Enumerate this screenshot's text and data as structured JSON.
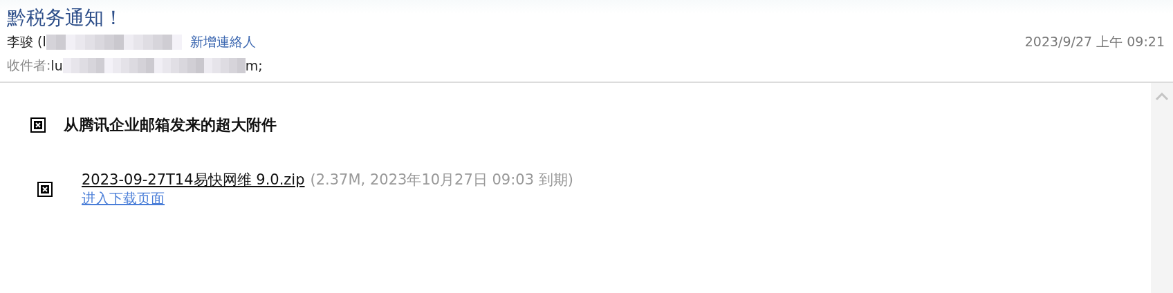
{
  "subject": "黔税务通知！",
  "sender": {
    "name": "李骏 (l",
    "add_contact": "新增連絡人"
  },
  "date": "2023/9/27 上午 09:21",
  "recipient": {
    "label": "收件者:",
    "value_start": "lu",
    "value_end": "m;"
  },
  "body": {
    "heading": "从腾讯企业邮箱发来的超大附件",
    "attachments": [
      {
        "file_name": "2023-09-27T14易快网维 9.0.zip",
        "info": "(2.37M, 2023年10月27日 09:03 到期)",
        "download_link": "进入下载页面"
      }
    ]
  }
}
